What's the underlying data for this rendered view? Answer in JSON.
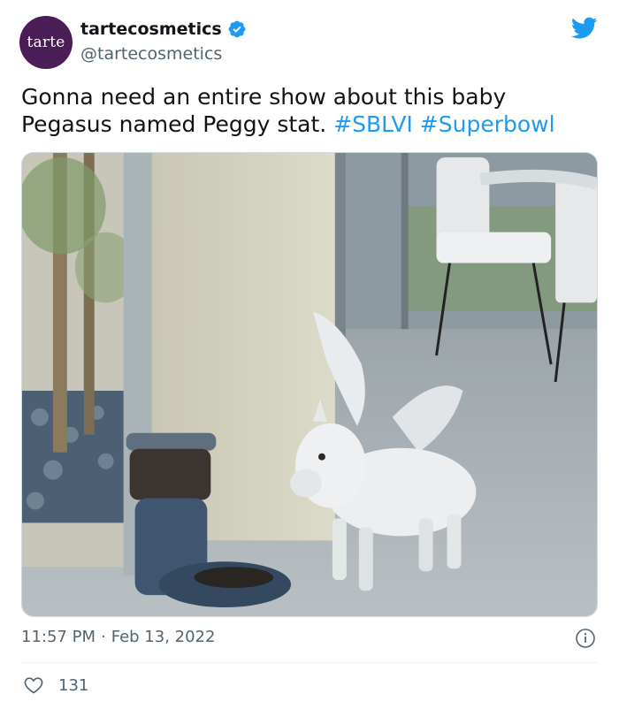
{
  "author": {
    "avatar_text": "tarte",
    "display_name": "tartecosmetics",
    "handle": "@tartecosmetics",
    "verified": true,
    "avatar_color": "#4b1d57"
  },
  "tweet": {
    "text": "Gonna need an entire show about this baby Pegasus named Peggy stat.",
    "hashtags": [
      "#SBLVI",
      "#Superbowl"
    ],
    "time": "11:57 PM",
    "separator": "·",
    "date": "Feb 13, 2022",
    "likes": "131"
  },
  "icons": {
    "brand": "twitter-bird-icon",
    "verified": "verified-badge-icon",
    "info": "info-icon",
    "like": "heart-icon"
  },
  "colors": {
    "link": "#1d9bf0",
    "secondary_text": "#536471",
    "primary_text": "#0f1419"
  }
}
